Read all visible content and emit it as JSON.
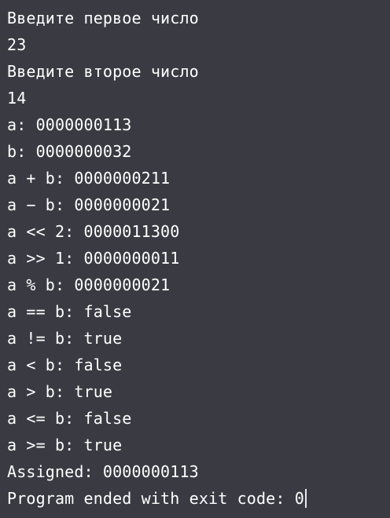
{
  "console": {
    "lines": [
      "Введите первое число",
      "23",
      "Введите второе число",
      "14",
      "a: 0000000113",
      "b: 0000000032",
      "a + b: 0000000211",
      "a − b: 0000000021",
      "a << 2: 0000011300",
      "a >> 1: 0000000011",
      "a % b: 0000000021",
      "a == b: false",
      "a != b: true",
      "a < b: false",
      "a > b: true",
      "a <= b: false",
      "a >= b: true",
      "Assigned: 0000000113",
      "Program ended with exit code: 0"
    ]
  }
}
